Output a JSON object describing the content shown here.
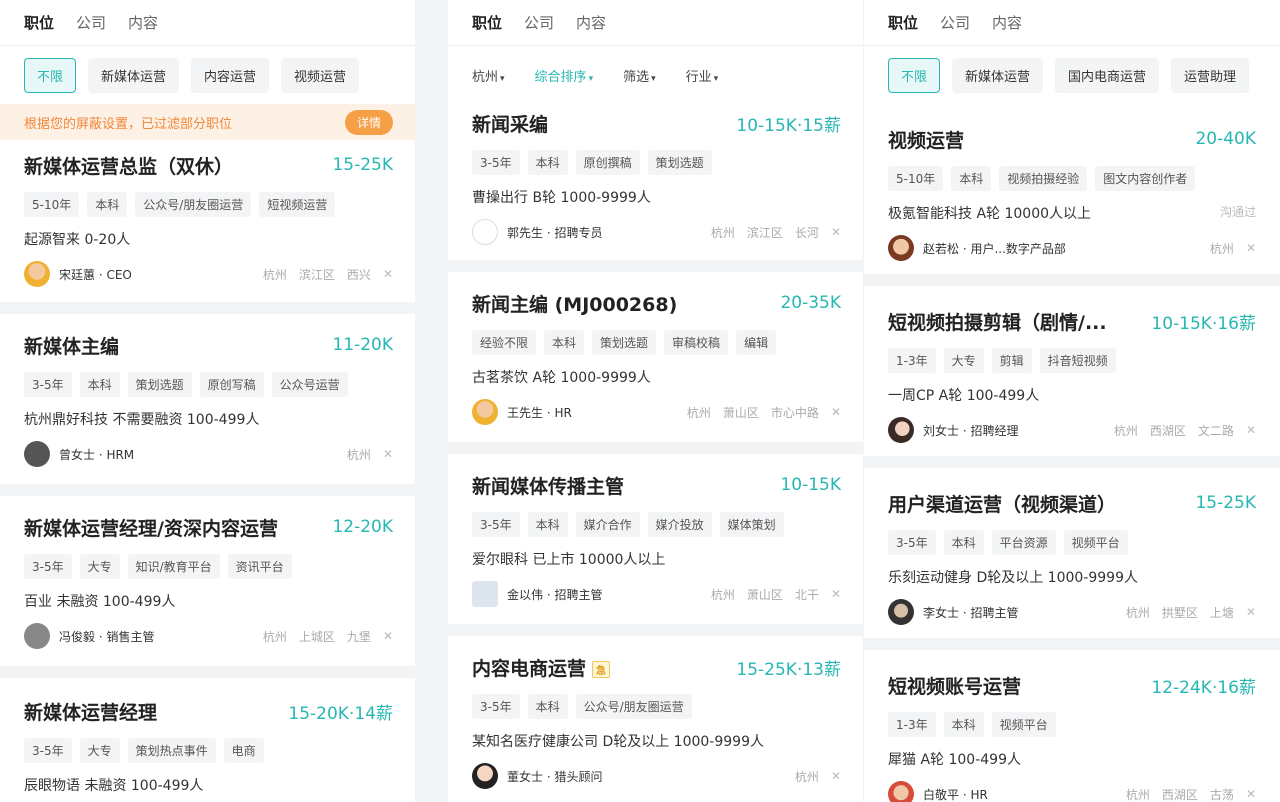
{
  "col1": {
    "tabs": [
      "职位",
      "公司",
      "内容"
    ],
    "filters": [
      "不限",
      "新媒体运营",
      "内容运营",
      "视频运营"
    ],
    "notice": {
      "text": "根据您的屏蔽设置，已过滤部分职位",
      "button": "详情"
    },
    "jobs": [
      {
        "title": "新媒体运营总监（双休）",
        "salary": "15-25K",
        "tags": [
          "5-10年",
          "本科",
          "公众号/朋友圈运营",
          "短视频运营"
        ],
        "company": "起源智来  0-20人",
        "boss": "宋廷蕙 · CEO",
        "loc": [
          "杭州",
          "滨江区",
          "西兴"
        ]
      },
      {
        "title": "新媒体主编",
        "salary": "11-20K",
        "tags": [
          "3-5年",
          "本科",
          "策划选题",
          "原创写稿",
          "公众号运营"
        ],
        "company": "杭州鼎好科技  不需要融资  100-499人",
        "boss": "曾女士 · HRM",
        "loc": [
          "杭州"
        ]
      },
      {
        "title": "新媒体运营经理/资深内容运营",
        "salary": "12-20K",
        "tags": [
          "3-5年",
          "大专",
          "知识/教育平台",
          "资讯平台"
        ],
        "company": "百业  未融资  100-499人",
        "boss": "冯俊毅 · 销售主管",
        "loc": [
          "杭州",
          "上城区",
          "九堡"
        ]
      },
      {
        "title": "新媒体运营经理",
        "salary": "15-20K·14薪",
        "tags": [
          "3-5年",
          "大专",
          "策划热点事件",
          "电商"
        ],
        "company": "辰眼物语  未融资  100-499人",
        "boss": "",
        "loc": []
      }
    ]
  },
  "col2": {
    "tabs": [
      "职位",
      "公司",
      "内容"
    ],
    "sort": [
      "杭州",
      "综合排序",
      "筛选",
      "行业"
    ],
    "jobs": [
      {
        "title": "新闻采编",
        "salary": "10-15K·15薪",
        "tags": [
          "3-5年",
          "本科",
          "原创撰稿",
          "策划选题"
        ],
        "company": "曹操出行  B轮  1000-9999人",
        "boss": "郭先生 · 招聘专员",
        "loc": [
          "杭州",
          "滨江区",
          "长河"
        ]
      },
      {
        "title": "新闻主编 (MJ000268)",
        "salary": "20-35K",
        "tags": [
          "经验不限",
          "本科",
          "策划选题",
          "审稿校稿",
          "编辑"
        ],
        "company": "古茗茶饮  A轮  1000-9999人",
        "boss": "王先生 · HR",
        "loc": [
          "杭州",
          "萧山区",
          "市心中路"
        ]
      },
      {
        "title": "新闻媒体传播主管",
        "salary": "10-15K",
        "tags": [
          "3-5年",
          "本科",
          "媒介合作",
          "媒介投放",
          "媒体策划"
        ],
        "company": "爱尔眼科  已上市  10000人以上",
        "boss": "金以伟 · 招聘主管",
        "loc": [
          "杭州",
          "萧山区",
          "北干"
        ]
      },
      {
        "title": "内容电商运营",
        "salary": "15-25K·13薪",
        "badge": "急",
        "tags": [
          "3-5年",
          "本科",
          "公众号/朋友圈运营"
        ],
        "company": "某知名医疗健康公司  D轮及以上  1000-9999人",
        "boss": "董女士 · 猎头顾问",
        "loc": [
          "杭州"
        ]
      }
    ]
  },
  "col3": {
    "tabs": [
      "职位",
      "公司",
      "内容"
    ],
    "filters": [
      "不限",
      "新媒体运营",
      "国内电商运营",
      "运营助理"
    ],
    "jobs": [
      {
        "title": "视频运营",
        "salary": "20-40K",
        "tags": [
          "5-10年",
          "本科",
          "视频拍摄经验",
          "图文内容创作者"
        ],
        "company": "极氪智能科技  A轮  10000人以上",
        "boss": "赵若松 · 用户...数字产品部",
        "loc": [
          "杭州"
        ],
        "viewed": "沟通过"
      },
      {
        "title": "短视频拍摄剪辑（剧情/...",
        "salary": "10-15K·16薪",
        "tags": [
          "1-3年",
          "大专",
          "剪辑",
          "抖音短视频"
        ],
        "company": "一周CP  A轮  100-499人",
        "boss": "刘女士 · 招聘经理",
        "loc": [
          "杭州",
          "西湖区",
          "文二路"
        ]
      },
      {
        "title": "用户渠道运营（视频渠道）",
        "salary": "15-25K",
        "tags": [
          "3-5年",
          "本科",
          "平台资源",
          "视频平台"
        ],
        "company": "乐刻运动健身  D轮及以上  1000-9999人",
        "boss": "李女士 · 招聘主管",
        "loc": [
          "杭州",
          "拱墅区",
          "上塘"
        ]
      },
      {
        "title": "短视频账号运营",
        "salary": "12-24K·16薪",
        "tags": [
          "1-3年",
          "本科",
          "视频平台"
        ],
        "company": "犀猫  A轮  100-499人",
        "boss": "白敬平 · HR",
        "loc": [
          "杭州",
          "西湖区",
          "古荡"
        ]
      }
    ]
  },
  "colors": {
    "accent": "#27b7b3",
    "notice": "#f0883a"
  }
}
